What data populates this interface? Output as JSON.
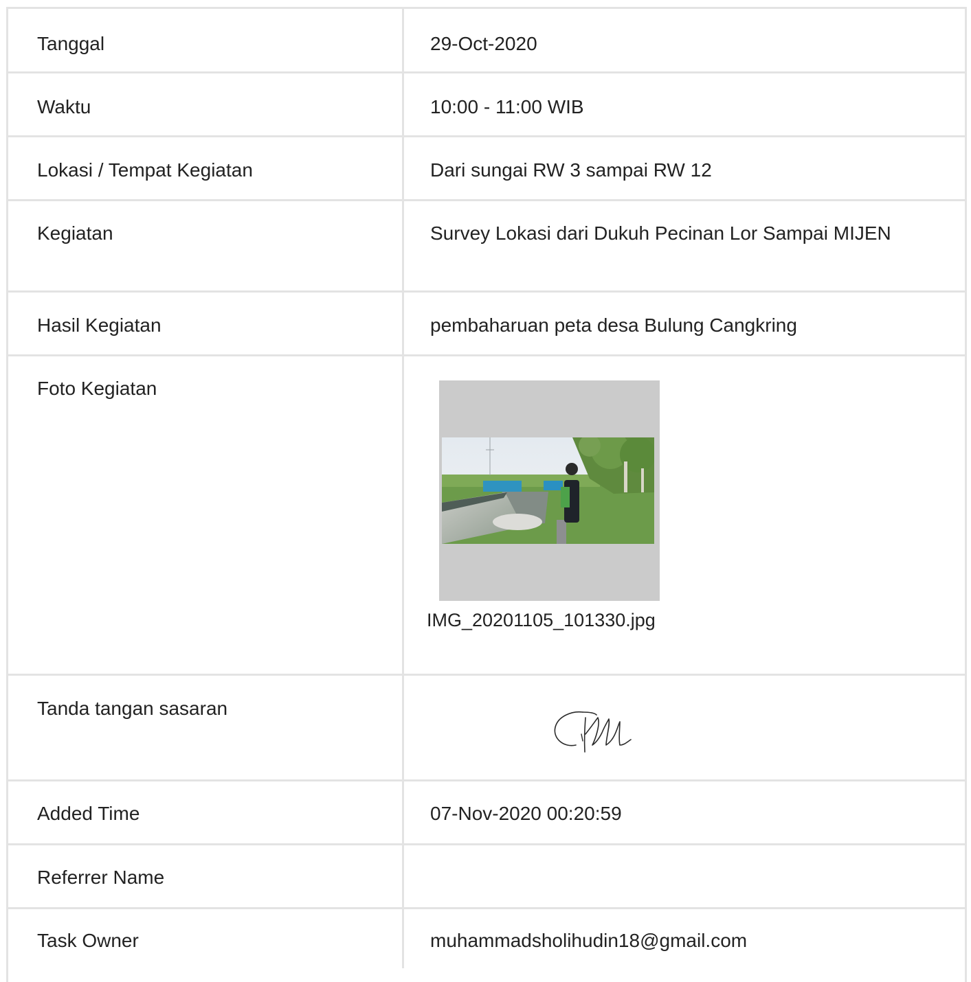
{
  "rows": [
    {
      "label": "Tanggal",
      "value": "29-Oct-2020"
    },
    {
      "label": "Waktu",
      "value": "10:00 - 11:00 WIB"
    },
    {
      "label": "Lokasi / Tempat Kegiatan",
      "value": "Dari sungai RW 3 sampai RW 12"
    },
    {
      "label": "Kegiatan",
      "value": "Survey Lokasi dari Dukuh Pecinan Lor Sampai MIJEN"
    },
    {
      "label": "Hasil Kegiatan",
      "value": "pembaharuan peta desa Bulung Cangkring"
    },
    {
      "label": "Foto Kegiatan",
      "value": "IMG_20201105_101330.jpg"
    },
    {
      "label": "Tanda tangan sasaran",
      "value": ""
    },
    {
      "label": "Added Time",
      "value": "07-Nov-2020 00:20:59"
    },
    {
      "label": "Referrer Name",
      "value": ""
    },
    {
      "label": "Task Owner",
      "value": "muhammadsholihudin18@gmail.com"
    }
  ]
}
